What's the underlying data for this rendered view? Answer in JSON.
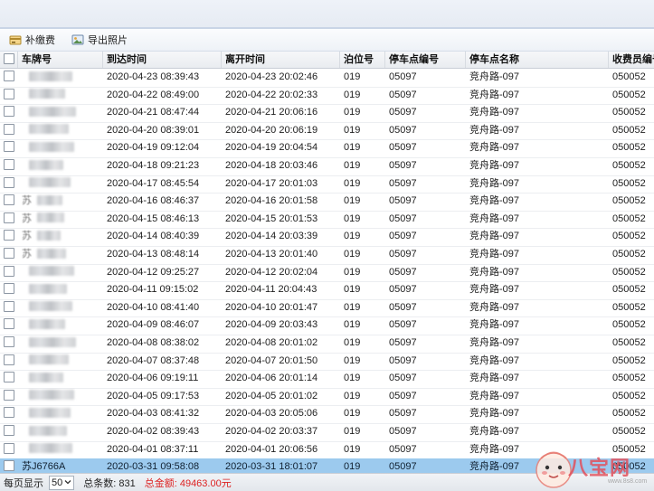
{
  "toolbar": {
    "supplement_label": "补缴费",
    "export_label": "导出照片"
  },
  "grid": {
    "headers": {
      "plate": "车牌号",
      "arrival": "到达时间",
      "departure": "离开时间",
      "berth": "泊位号",
      "lot_code": "停车点编号",
      "lot_name": "停车点名称",
      "collector": "收费员编号"
    },
    "rows": [
      {
        "plate": "",
        "arrival": "2020-04-23 08:39:43",
        "departure": "2020-04-23 20:02:46",
        "berth": "019",
        "lot_code": "05097",
        "lot_name": "竞舟路-097",
        "collector": "050052"
      },
      {
        "plate": "",
        "arrival": "2020-04-22 08:49:00",
        "departure": "2020-04-22 20:02:33",
        "berth": "019",
        "lot_code": "05097",
        "lot_name": "竞舟路-097",
        "collector": "050052"
      },
      {
        "plate": "",
        "arrival": "2020-04-21 08:47:44",
        "departure": "2020-04-21 20:06:16",
        "berth": "019",
        "lot_code": "05097",
        "lot_name": "竞舟路-097",
        "collector": "050052"
      },
      {
        "plate": "",
        "arrival": "2020-04-20 08:39:01",
        "departure": "2020-04-20 20:06:19",
        "berth": "019",
        "lot_code": "05097",
        "lot_name": "竞舟路-097",
        "collector": "050052"
      },
      {
        "plate": "",
        "arrival": "2020-04-19 09:12:04",
        "departure": "2020-04-19 20:04:54",
        "berth": "019",
        "lot_code": "05097",
        "lot_name": "竞舟路-097",
        "collector": "050052"
      },
      {
        "plate": "",
        "arrival": "2020-04-18 09:21:23",
        "departure": "2020-04-18 20:03:46",
        "berth": "019",
        "lot_code": "05097",
        "lot_name": "竞舟路-097",
        "collector": "050052"
      },
      {
        "plate": "",
        "arrival": "2020-04-17 08:45:54",
        "departure": "2020-04-17 20:01:03",
        "berth": "019",
        "lot_code": "05097",
        "lot_name": "竞舟路-097",
        "collector": "050052"
      },
      {
        "plate": "苏",
        "arrival": "2020-04-16 08:46:37",
        "departure": "2020-04-16 20:01:58",
        "berth": "019",
        "lot_code": "05097",
        "lot_name": "竞舟路-097",
        "collector": "050052"
      },
      {
        "plate": "苏",
        "arrival": "2020-04-15 08:46:13",
        "departure": "2020-04-15 20:01:53",
        "berth": "019",
        "lot_code": "05097",
        "lot_name": "竞舟路-097",
        "collector": "050052"
      },
      {
        "plate": "苏",
        "arrival": "2020-04-14 08:40:39",
        "departure": "2020-04-14 20:03:39",
        "berth": "019",
        "lot_code": "05097",
        "lot_name": "竞舟路-097",
        "collector": "050052"
      },
      {
        "plate": "苏",
        "arrival": "2020-04-13 08:48:14",
        "departure": "2020-04-13 20:01:40",
        "berth": "019",
        "lot_code": "05097",
        "lot_name": "竞舟路-097",
        "collector": "050052"
      },
      {
        "plate": "",
        "arrival": "2020-04-12 09:25:27",
        "departure": "2020-04-12 20:02:04",
        "berth": "019",
        "lot_code": "05097",
        "lot_name": "竞舟路-097",
        "collector": "050052"
      },
      {
        "plate": "",
        "arrival": "2020-04-11 09:15:02",
        "departure": "2020-04-11 20:04:43",
        "berth": "019",
        "lot_code": "05097",
        "lot_name": "竞舟路-097",
        "collector": "050052"
      },
      {
        "plate": "",
        "arrival": "2020-04-10 08:41:40",
        "departure": "2020-04-10 20:01:47",
        "berth": "019",
        "lot_code": "05097",
        "lot_name": "竞舟路-097",
        "collector": "050052"
      },
      {
        "plate": "",
        "arrival": "2020-04-09 08:46:07",
        "departure": "2020-04-09 20:03:43",
        "berth": "019",
        "lot_code": "05097",
        "lot_name": "竞舟路-097",
        "collector": "050052"
      },
      {
        "plate": "",
        "arrival": "2020-04-08 08:38:02",
        "departure": "2020-04-08 20:01:02",
        "berth": "019",
        "lot_code": "05097",
        "lot_name": "竞舟路-097",
        "collector": "050052"
      },
      {
        "plate": "",
        "arrival": "2020-04-07 08:37:48",
        "departure": "2020-04-07 20:01:50",
        "berth": "019",
        "lot_code": "05097",
        "lot_name": "竞舟路-097",
        "collector": "050052"
      },
      {
        "plate": "",
        "arrival": "2020-04-06 09:19:11",
        "departure": "2020-04-06 20:01:14",
        "berth": "019",
        "lot_code": "05097",
        "lot_name": "竞舟路-097",
        "collector": "050052"
      },
      {
        "plate": "",
        "arrival": "2020-04-05 09:17:53",
        "departure": "2020-04-05 20:01:02",
        "berth": "019",
        "lot_code": "05097",
        "lot_name": "竞舟路-097",
        "collector": "050052"
      },
      {
        "plate": "",
        "arrival": "2020-04-03 08:41:32",
        "departure": "2020-04-03 20:05:06",
        "berth": "019",
        "lot_code": "05097",
        "lot_name": "竞舟路-097",
        "collector": "050052"
      },
      {
        "plate": "",
        "arrival": "2020-04-02 08:39:43",
        "departure": "2020-04-02 20:03:37",
        "berth": "019",
        "lot_code": "05097",
        "lot_name": "竞舟路-097",
        "collector": "050052"
      },
      {
        "plate": "",
        "arrival": "2020-04-01 08:37:11",
        "departure": "2020-04-01 20:06:56",
        "berth": "019",
        "lot_code": "05097",
        "lot_name": "竞舟路-097",
        "collector": "050052"
      },
      {
        "plate": "苏J6766A",
        "arrival": "2020-03-31 09:58:08",
        "departure": "2020-03-31 18:01:07",
        "berth": "019",
        "lot_code": "05097",
        "lot_name": "竞舟路-097",
        "collector": "050052",
        "selected": true
      }
    ]
  },
  "statusbar": {
    "page_size_label": "每页显示",
    "page_size_value": "50",
    "total_count_label": "总条数: 831",
    "total_amount_label": "总金额: 49463.00元"
  },
  "watermark": {
    "text": "八宝网",
    "sub": "www.8s8.com"
  },
  "colors": {
    "selected_row": "#9ccaee",
    "total_amount": "#dd2222",
    "watermark": "#e2505a"
  },
  "icons": {
    "supplement": "payment-icon",
    "export": "export-photo-icon",
    "dropdown": "chevron-down-icon"
  }
}
